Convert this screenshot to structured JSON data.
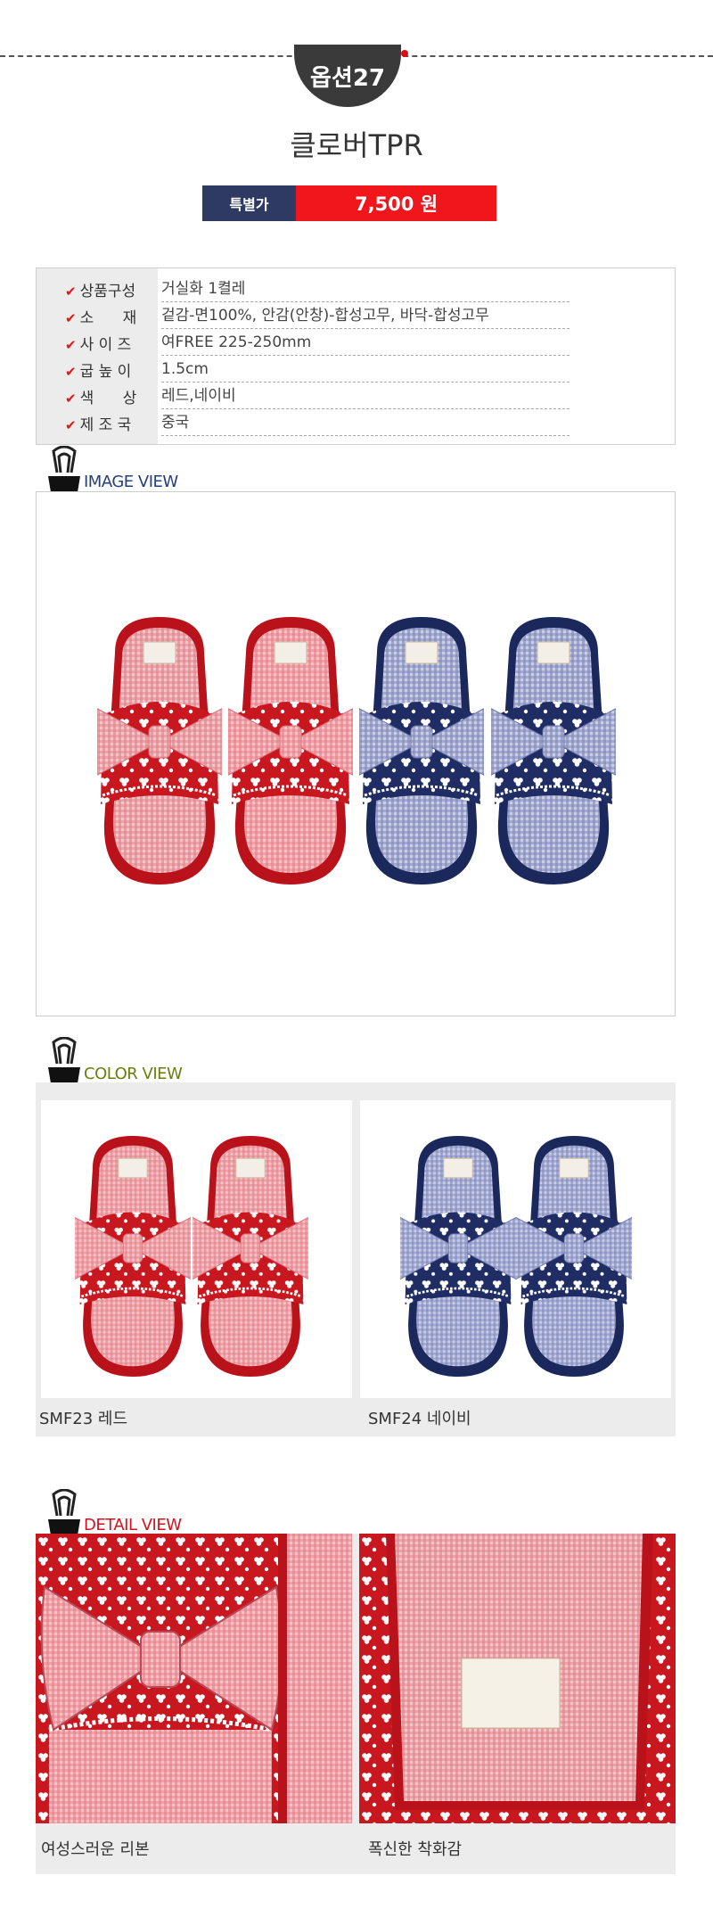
{
  "option": {
    "label": "옵션27"
  },
  "product": {
    "name": "클로버TPR"
  },
  "price": {
    "label": "특별가",
    "value": "7,500 원"
  },
  "specs": [
    {
      "label": "상품구성",
      "value": "거실화 1켤레"
    },
    {
      "label": "소      재",
      "value": "겉감-면100%, 안감(안창)-합성고무, 바닥-합성고무"
    },
    {
      "label": "사 이 즈",
      "value": "여FREE 225-250mm"
    },
    {
      "label": "굽 높 이",
      "value": "1.5cm"
    },
    {
      "label": "색      상",
      "value": "레드,네이비"
    },
    {
      "label": "제 조 국",
      "value": "중국"
    }
  ],
  "sections": {
    "image_view": "IMAGE VIEW",
    "color_view": "COLOR VIEW",
    "detail_view": "DETAIL VIEW"
  },
  "colors": {
    "items": [
      {
        "caption": "SMF23 레드",
        "color": "#c8171f"
      },
      {
        "caption": "SMF24 네이비",
        "color": "#1f2d64"
      }
    ]
  },
  "details": {
    "items": [
      {
        "caption": "여성스러운 리본"
      },
      {
        "caption": "폭신한 착화감"
      }
    ]
  },
  "theme": {
    "accent_red": "#e10a17",
    "navy": "#2e3a62",
    "image_view_color": "#25407f",
    "color_view_color": "#6a7d10",
    "detail_view_color": "#d3121b"
  }
}
